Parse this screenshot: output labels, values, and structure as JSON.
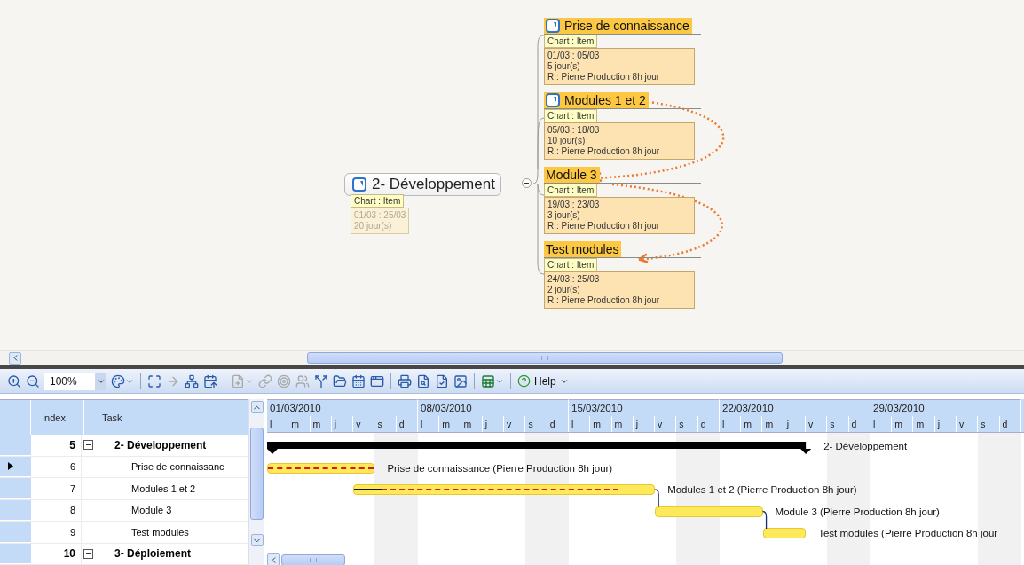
{
  "mind_map": {
    "root": {
      "title": "2- Développement",
      "expanded": true,
      "tag": "Chart : Item",
      "info": [
        "01/03 : 25/03",
        "20 jour(s)"
      ],
      "faded": true
    },
    "children": [
      {
        "title": "Prise de connaissance",
        "kind": "icon",
        "tag": "Chart : Item",
        "info": [
          "01/03 : 05/03",
          "5 jour(s)",
          "R : Pierre Production 8h jour"
        ]
      },
      {
        "title": "Modules 1 et 2",
        "kind": "icon",
        "linked": false,
        "tag": "Chart : Item",
        "info": [
          "05/03 : 18/03",
          "10 jour(s)",
          "R : Pierre Production 8h jour"
        ]
      },
      {
        "title": "Module 3",
        "kind": "plain",
        "linked": true,
        "tag": "Chart : Item",
        "info": [
          "19/03 : 23/03",
          "3 jour(s)",
          "R : Pierre Production 8h jour"
        ]
      },
      {
        "title": "Test modules",
        "kind": "plain",
        "linked": true,
        "tag": "Chart : Item",
        "info": [
          "24/03 : 25/03",
          "2 jour(s)",
          "R : Pierre Production 8h jour"
        ]
      }
    ]
  },
  "toolbar": {
    "zoom": "100%",
    "help": "Help"
  },
  "gantt": {
    "columns": [
      "Index",
      "Task"
    ],
    "weeks": [
      {
        "label": "01/03/2010",
        "days": [
          "l",
          "m",
          "m",
          "j",
          "v",
          "s",
          "d"
        ]
      },
      {
        "label": "08/03/2010",
        "days": [
          "l",
          "m",
          "m",
          "j",
          "v",
          "s",
          "d"
        ]
      },
      {
        "label": "15/03/2010",
        "days": [
          "l",
          "m",
          "m",
          "j",
          "v",
          "s",
          "d"
        ]
      },
      {
        "label": "22/03/2010",
        "days": [
          "l",
          "m",
          "m",
          "j",
          "v",
          "s",
          "d"
        ]
      },
      {
        "label": "29/03/2010",
        "days": [
          "l",
          "m",
          "m",
          "j",
          "v",
          "s",
          "d"
        ]
      }
    ],
    "rows": [
      {
        "index": "5",
        "task": "2- Développement",
        "kind": "summary",
        "expanded": true,
        "selected": false,
        "label": "2- Développement"
      },
      {
        "index": "6",
        "task": "Prise de connaissanc",
        "kind": "task",
        "selected": true,
        "critical": true,
        "level": 0,
        "label": "Prise de connaissance (Pierre Production 8h jour)"
      },
      {
        "index": "7",
        "task": "Modules 1 et 2",
        "kind": "task",
        "selected": false,
        "critical": true,
        "level": 0.09,
        "label": "Modules 1 et 2 (Pierre Production 8h jour)"
      },
      {
        "index": "8",
        "task": "Module 3",
        "kind": "task",
        "selected": false,
        "critical": false,
        "level": 0,
        "label": "Module 3 (Pierre Production 8h jour)"
      },
      {
        "index": "9",
        "task": "Test modules",
        "kind": "task",
        "selected": false,
        "critical": false,
        "level": 0,
        "label": "Test modules (Pierre Production 8h jour"
      },
      {
        "index": "10",
        "task": "3- Déploiement",
        "kind": "summary",
        "expanded": true,
        "selected": false
      }
    ]
  }
}
